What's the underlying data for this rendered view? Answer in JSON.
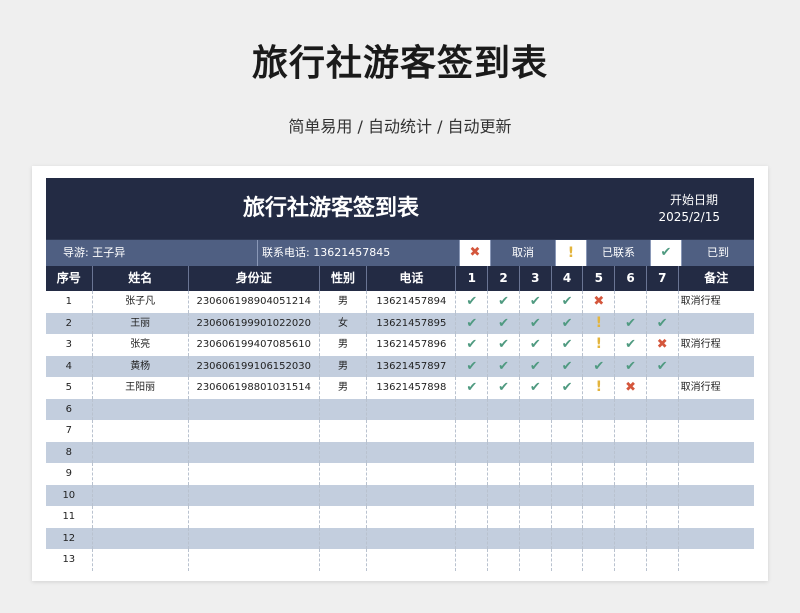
{
  "page": {
    "title": "旅行社游客签到表",
    "subtitle": "简单易用 / 自动统计 / 自动更新"
  },
  "sheet": {
    "title": "旅行社游客签到表",
    "start_label": "开始日期",
    "start_date": "2025/2/15"
  },
  "info": {
    "guide": "导游: 王子异",
    "phone": "联系电话:   13621457845",
    "legend": [
      {
        "icon": "cross-icon",
        "label": "取消"
      },
      {
        "icon": "exclamation-icon",
        "label": "已联系"
      },
      {
        "icon": "check-icon",
        "label": "已到"
      }
    ]
  },
  "colors": {
    "banner": "#232b44",
    "info_bar": "#4f5f82",
    "stripe": "#c3cede",
    "check": "#4f9a80",
    "cross": "#d4563c",
    "bang": "#e3b43c"
  },
  "symbols": {
    "check": "✔",
    "cross": "✖",
    "bang": "!"
  },
  "table": {
    "columns": [
      "序号",
      "姓名",
      "身份证",
      "性别",
      "电话",
      "1",
      "2",
      "3",
      "4",
      "5",
      "6",
      "7",
      "备注"
    ],
    "rows": [
      {
        "no": "1",
        "name": "张子凡",
        "id": "230606198904051214",
        "gender": "男",
        "phone": "13621457894",
        "days": [
          "check",
          "check",
          "check",
          "check",
          "cross",
          "",
          ""
        ],
        "remark": "取消行程"
      },
      {
        "no": "2",
        "name": "王丽",
        "id": "230606199901022020",
        "gender": "女",
        "phone": "13621457895",
        "days": [
          "check",
          "check",
          "check",
          "check",
          "bang",
          "check",
          "check"
        ],
        "remark": ""
      },
      {
        "no": "3",
        "name": "张亮",
        "id": "230606199407085610",
        "gender": "男",
        "phone": "13621457896",
        "days": [
          "check",
          "check",
          "check",
          "check",
          "bang",
          "check",
          "cross"
        ],
        "remark": "取消行程"
      },
      {
        "no": "4",
        "name": "黄杨",
        "id": "230606199106152030",
        "gender": "男",
        "phone": "13621457897",
        "days": [
          "check",
          "check",
          "check",
          "check",
          "check",
          "check",
          "check"
        ],
        "remark": ""
      },
      {
        "no": "5",
        "name": "王阳丽",
        "id": "230606198801031514",
        "gender": "男",
        "phone": "13621457898",
        "days": [
          "check",
          "check",
          "check",
          "check",
          "bang",
          "cross",
          ""
        ],
        "remark": "取消行程"
      },
      {
        "no": "6",
        "name": "",
        "id": "",
        "gender": "",
        "phone": "",
        "days": [
          "",
          "",
          "",
          "",
          "",
          "",
          ""
        ],
        "remark": ""
      },
      {
        "no": "7",
        "name": "",
        "id": "",
        "gender": "",
        "phone": "",
        "days": [
          "",
          "",
          "",
          "",
          "",
          "",
          ""
        ],
        "remark": ""
      },
      {
        "no": "8",
        "name": "",
        "id": "",
        "gender": "",
        "phone": "",
        "days": [
          "",
          "",
          "",
          "",
          "",
          "",
          ""
        ],
        "remark": ""
      },
      {
        "no": "9",
        "name": "",
        "id": "",
        "gender": "",
        "phone": "",
        "days": [
          "",
          "",
          "",
          "",
          "",
          "",
          ""
        ],
        "remark": ""
      },
      {
        "no": "10",
        "name": "",
        "id": "",
        "gender": "",
        "phone": "",
        "days": [
          "",
          "",
          "",
          "",
          "",
          "",
          ""
        ],
        "remark": ""
      },
      {
        "no": "11",
        "name": "",
        "id": "",
        "gender": "",
        "phone": "",
        "days": [
          "",
          "",
          "",
          "",
          "",
          "",
          ""
        ],
        "remark": ""
      },
      {
        "no": "12",
        "name": "",
        "id": "",
        "gender": "",
        "phone": "",
        "days": [
          "",
          "",
          "",
          "",
          "",
          "",
          ""
        ],
        "remark": ""
      },
      {
        "no": "13",
        "name": "",
        "id": "",
        "gender": "",
        "phone": "",
        "days": [
          "",
          "",
          "",
          "",
          "",
          "",
          ""
        ],
        "remark": ""
      }
    ]
  }
}
